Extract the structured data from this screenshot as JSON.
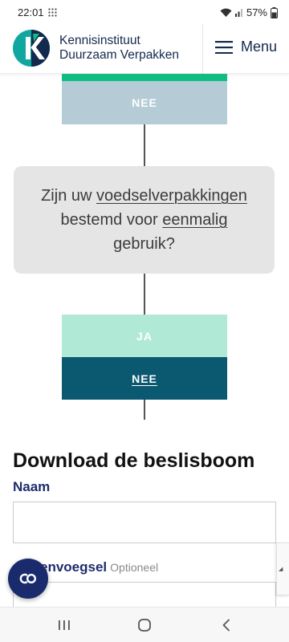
{
  "status_bar": {
    "time": "22:01",
    "battery": "57%"
  },
  "header": {
    "brand_line1": "Kennisinstituut",
    "brand_line2": "Duurzaam Verpakken",
    "menu_label": "Menu"
  },
  "tree": {
    "top_answer": "NEE",
    "question_parts": [
      "Zijn uw ",
      "voedselverpakkingen",
      " bestemd voor ",
      "eenmalig",
      " gebruik?"
    ],
    "answer_ja": "JA",
    "answer_nee": "NEE"
  },
  "form": {
    "title": "Download de beslisboom",
    "naam_label": "Naam",
    "naam_value": "",
    "tussen_label": "Tussenvoegsel",
    "tussen_visible_label": "envoegsel",
    "tussen_optional": "Optioneel"
  },
  "colors": {
    "green": "#0fbd82",
    "nee_top": "#b5cbd6",
    "ja": "#b1e9d7",
    "nee_bottom": "#0b5871",
    "navy": "#1d2c6b"
  },
  "icons": {
    "menu": "hamburger-icon",
    "chat": "co-chat-icon",
    "nav_recent": "recent-apps-icon",
    "nav_home": "home-icon",
    "nav_back": "back-icon"
  }
}
